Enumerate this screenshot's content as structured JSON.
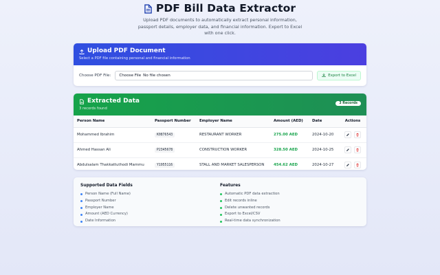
{
  "header": {
    "title": "PDF Bill Data Extractor",
    "icon": "document-icon",
    "subtitle": "Upload PDF documents to automatically extract personal information, passport details, employer data, and financial information. Export to Excel with one click."
  },
  "upload": {
    "title": "Upload PDF Document",
    "subtitle": "Select a PDF file containing personal and financial information",
    "label": "Choose PDF File:",
    "file_button": "Choose File",
    "file_status": "No file chosen",
    "export_label": "Export to Excel"
  },
  "extracted": {
    "title": "Extracted Data",
    "count_text": "3 records found",
    "badge": "3 Records",
    "columns": {
      "name": "Person Name",
      "passport": "Passport Number",
      "employer": "Employer Name",
      "amount": "Amount (AED)",
      "date": "Date",
      "actions": "Actions"
    },
    "rows": [
      {
        "name": "Mohammed Ibrahim",
        "passport": "K0876543",
        "employer": "RESTAURANT WORKER",
        "amount": "275.00 AED",
        "date": "2024-10-20"
      },
      {
        "name": "Ahmed Hassan Ali",
        "passport": "P2345678",
        "employer": "CONSTRUCTION WORKER",
        "amount": "328.50 AED",
        "date": "2024-10-25"
      },
      {
        "name": "Abdulsalam Thakkattuthodi Mammu",
        "passport": "Y1955116",
        "employer": "STALL AND MARKET SALESPERSON",
        "amount": "454.62 AED",
        "date": "2024-10-27"
      }
    ]
  },
  "info": {
    "supported_title": "Supported Data Fields",
    "supported": [
      "Person Name (Full Name)",
      "Passport Number",
      "Employer Name",
      "Amount (AED Currency)",
      "Date Information"
    ],
    "features_title": "Features",
    "features": [
      "Automatic PDF data extraction",
      "Edit records inline",
      "Delete unwanted records",
      "Export to Excel/CSV",
      "Real-time data synchronization"
    ]
  },
  "colors": {
    "upload_header": "#3b4fe0",
    "data_header": "#16a34a",
    "amount": "#16a34a",
    "delete": "#dc2626"
  }
}
